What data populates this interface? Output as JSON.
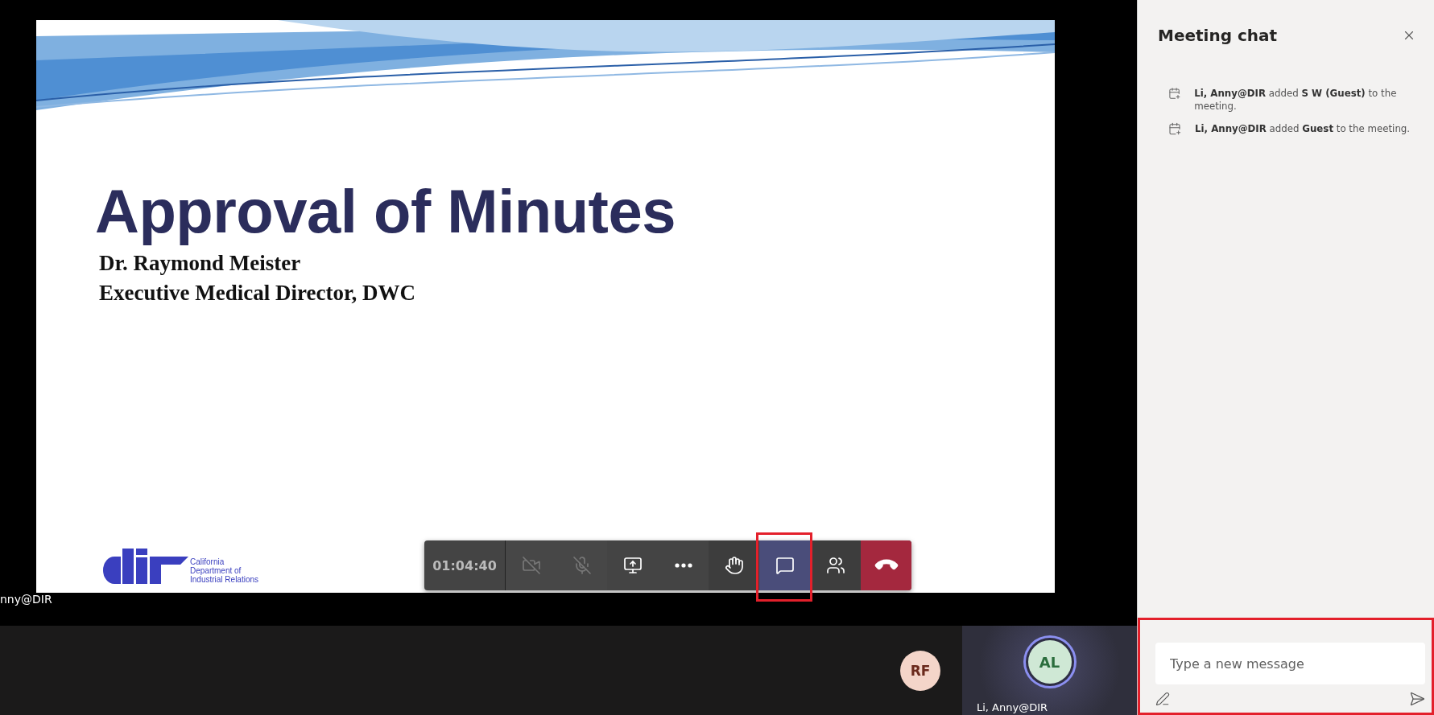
{
  "slide": {
    "title": "Approval of Minutes",
    "lines": [
      "Dr. Raymond Meister",
      "Executive Medical Director, DWC"
    ],
    "logo_lines": [
      "California",
      "Department of",
      "Industrial Relations"
    ]
  },
  "presenter_label": "nny@DIR",
  "toolbar": {
    "timer": "01:04:40",
    "buttons": [
      {
        "kind": "camera",
        "disabled": true,
        "selected": false,
        "highlighted": false
      },
      {
        "kind": "mic",
        "disabled": true,
        "selected": false,
        "highlighted": false
      },
      {
        "kind": "share",
        "disabled": false,
        "selected": false,
        "highlighted": false
      },
      {
        "kind": "more",
        "disabled": false,
        "selected": false,
        "highlighted": false
      },
      {
        "kind": "hand",
        "disabled": false,
        "selected": false,
        "highlighted": false
      },
      {
        "kind": "chat",
        "disabled": false,
        "selected": true,
        "highlighted": true
      },
      {
        "kind": "people",
        "disabled": false,
        "selected": false,
        "highlighted": false
      },
      {
        "kind": "hangup",
        "disabled": false,
        "selected": false,
        "highlighted": false
      }
    ]
  },
  "participants": [
    {
      "initials": "RF",
      "color": "#f4d5c9",
      "speaking": false
    },
    {
      "initials": "AL",
      "color": "#cfe8d5",
      "speaking": true,
      "name": "Li, Anny@DIR"
    }
  ],
  "chat": {
    "title": "Meeting chat",
    "messages": [
      {
        "text": "**Li, Anny@DIR** added **S W (Guest)** to the meeting."
      },
      {
        "text": "**Li, Anny@DIR** added **Guest** to the meeting."
      }
    ],
    "composer": {
      "placeholder": "Type a new message",
      "highlighted": true
    }
  }
}
